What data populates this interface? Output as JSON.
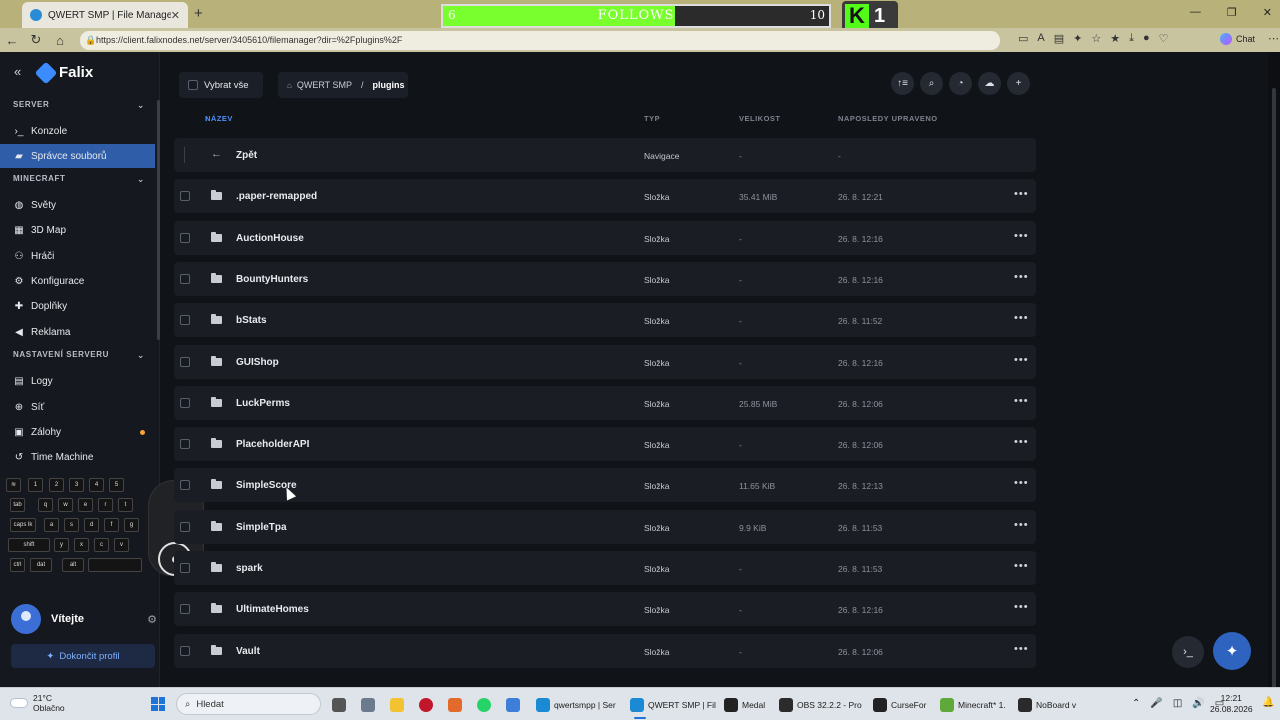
{
  "browser": {
    "tab_title": "QWERT SMP | File Manager",
    "url": "https://client.falixnodes.net/server/3405610/filemanager?dir=%2Fplugins%2F",
    "chat_label": "Chat"
  },
  "overlay": {
    "follows_label": "FOLLOWS",
    "follows_current": "6",
    "follows_goal": "10",
    "follows_progress": 0.6,
    "kick_letter": "K",
    "kick_count": "1",
    "keyboard_keys": [
      "1",
      "2",
      "3",
      "4",
      "5",
      "tab",
      "q",
      "w",
      "e",
      "r",
      "t",
      "caps lk",
      "a",
      "s",
      "d",
      "f",
      "g",
      "shift",
      "y",
      "x",
      "c",
      "v",
      "ctrl",
      "dat",
      "alt"
    ]
  },
  "sidebar": {
    "logo": "Falix",
    "sections": [
      {
        "title": "SERVER",
        "items": [
          {
            "label": "Konzole",
            "icon": "terminal-icon"
          },
          {
            "label": "Správce souborů",
            "icon": "folder-icon",
            "active": true
          }
        ]
      },
      {
        "title": "MINECRAFT",
        "items": [
          {
            "label": "Světy",
            "icon": "globe-icon"
          },
          {
            "label": "3D Map",
            "icon": "map-icon"
          },
          {
            "label": "Hráči",
            "icon": "users-icon"
          },
          {
            "label": "Konfigurace",
            "icon": "settings-icon"
          },
          {
            "label": "Doplňky",
            "icon": "puzzle-icon"
          },
          {
            "label": "Reklama",
            "icon": "megaphone-icon"
          }
        ]
      },
      {
        "title": "NASTAVENÍ SERVERU",
        "items": [
          {
            "label": "Logy",
            "icon": "file-icon"
          },
          {
            "label": "Síť",
            "icon": "network-icon"
          },
          {
            "label": "Zálohy",
            "icon": "backup-icon",
            "badge": true
          },
          {
            "label": "Time Machine",
            "icon": "history-icon"
          }
        ]
      }
    ],
    "user_name": "Vítejte",
    "profile_button": "Dokončit profil"
  },
  "toolbar": {
    "select_all": "Vybrat vše",
    "breadcrumb_root": "QWERT SMP",
    "breadcrumb_sep": "/",
    "breadcrumb_current": "plugins"
  },
  "table": {
    "headers": {
      "name": "NÁZEV",
      "type": "TYP",
      "size": "VELIKOST",
      "modified": "NAPOSLEDY UPRAVENO"
    },
    "back_row": {
      "name": "Zpět",
      "type": "Navigace",
      "size": "-",
      "modified": "-"
    },
    "rows": [
      {
        "name": ".paper-remapped",
        "type": "Složka",
        "size": "35.41 MiB",
        "modified": "26. 8. 12:21"
      },
      {
        "name": "AuctionHouse",
        "type": "Složka",
        "size": "-",
        "modified": "26. 8. 12:16"
      },
      {
        "name": "BountyHunters",
        "type": "Složka",
        "size": "-",
        "modified": "26. 8. 12:16"
      },
      {
        "name": "bStats",
        "type": "Složka",
        "size": "-",
        "modified": "26. 8. 11:52"
      },
      {
        "name": "GUIShop",
        "type": "Složka",
        "size": "-",
        "modified": "26. 8. 12:16"
      },
      {
        "name": "LuckPerms",
        "type": "Složka",
        "size": "25.85 MiB",
        "modified": "26. 8. 12:06"
      },
      {
        "name": "PlaceholderAPI",
        "type": "Složka",
        "size": "-",
        "modified": "26. 8. 12:06"
      },
      {
        "name": "SimpleScore",
        "type": "Složka",
        "size": "11.65 KiB",
        "modified": "26. 8. 12:13"
      },
      {
        "name": "SimpleTpa",
        "type": "Složka",
        "size": "9.9 KiB",
        "modified": "26. 8. 11:53"
      },
      {
        "name": "spark",
        "type": "Složka",
        "size": "-",
        "modified": "26. 8. 11:53"
      },
      {
        "name": "UltimateHomes",
        "type": "Složka",
        "size": "-",
        "modified": "26. 8. 12:16"
      },
      {
        "name": "Vault",
        "type": "Složka",
        "size": "-",
        "modified": "26. 8. 12:06"
      }
    ]
  },
  "taskbar": {
    "temperature": "21°C",
    "weather": "Oblačno",
    "search_placeholder": "Hledat",
    "apps": [
      {
        "label": "qwertsmpp | Ser",
        "color": "#1a8ad4"
      },
      {
        "label": "QWERT SMP | Fil",
        "color": "#1a8ad4",
        "active": true
      },
      {
        "label": "Medal",
        "color": "#222222"
      },
      {
        "label": "OBS 32.2.2 - Pro",
        "color": "#2b2b2b"
      },
      {
        "label": "CurseFor",
        "color": "#222222"
      },
      {
        "label": "Minecraft* 1.",
        "color": "#5fa83a"
      },
      {
        "label": "NoBoard v",
        "color": "#2a2a2a"
      }
    ],
    "time": "12:21",
    "date": "26.08.2026"
  }
}
